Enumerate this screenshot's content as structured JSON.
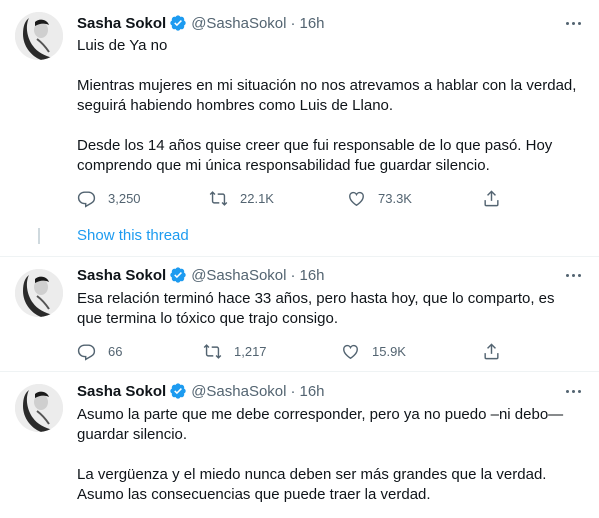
{
  "tweets": [
    {
      "name": "Sasha Sokol",
      "handle": "@SashaSokol",
      "dot": "·",
      "time": "16h",
      "body": [
        "Luis de Ya no",
        "",
        "Mientras mujeres en mi situación no nos atrevamos a hablar con la verdad,",
        "seguirá habiendo hombres como Luis de Llano.",
        "",
        "Desde los 14 años quise creer que fui responsable de lo que pasó. Hoy",
        "comprendo que mi única responsabilidad fue guardar silencio."
      ],
      "replies": "3,250",
      "retweets": "22.1K",
      "likes": "73.3K"
    },
    {
      "name": "Sasha Sokol",
      "handle": "@SashaSokol",
      "dot": "·",
      "time": "16h",
      "body": [
        "Esa relación terminó hace 33 años, pero hasta hoy, que lo comparto, es",
        "que termina lo tóxico que trajo consigo."
      ],
      "replies": "66",
      "retweets": "1,217",
      "likes": "15.9K"
    },
    {
      "name": "Sasha Sokol",
      "handle": "@SashaSokol",
      "dot": "·",
      "time": "16h",
      "body": [
        "Asumo la parte que me debe corresponder, pero ya no puedo –ni debo—",
        "guardar silencio.",
        "",
        "La vergüenza y el miedo nunca deben ser más grandes que la verdad.",
        "Asumo las consecuencias que puede traer la verdad."
      ]
    }
  ],
  "show_thread": "Show this thread",
  "colors": {
    "accent": "#1d9bf0",
    "text": "#0f1419",
    "secondary": "#536471",
    "divider": "#eff3f4"
  },
  "icons": [
    "verified-badge-icon",
    "more-icon",
    "reply-icon",
    "retweet-icon",
    "like-icon",
    "share-icon"
  ]
}
